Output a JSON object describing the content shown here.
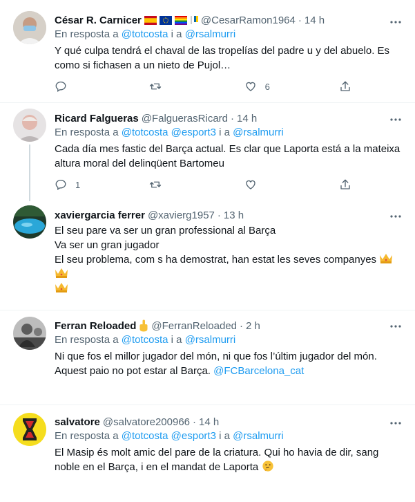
{
  "tweets": [
    {
      "name": "César R. Carnicer",
      "flags": [
        "spain-flag",
        "eu-flag",
        "pride-flag",
        "canary-flag"
      ],
      "handle": "@CesarRamon1964",
      "dot": "·",
      "time": "14 h",
      "reply_prefix": "En resposta a",
      "reply_mentions": [
        "@totcosta",
        "@rsalmurri"
      ],
      "reply_join": [
        "i a"
      ],
      "text": "Y qué culpa tendrá el chaval de las tropelías del padre u y del abuelo. Es como si fichasen a un nieto de Pujol…",
      "replies": "",
      "retweets": "",
      "likes": "6"
    },
    {
      "name": "Ricard Falgueras",
      "handle": "@FalguerasRicard",
      "dot": "·",
      "time": "14 h",
      "reply_prefix": "En resposta a",
      "reply_mentions": [
        "@totcosta",
        "@esport3",
        "@rsalmurri"
      ],
      "reply_join": [
        "i a"
      ],
      "text": "Cada día mes fastic del Barça actual. Es clar que Laporta está a la mateixa altura moral del delinqüent Bartomeu",
      "replies": "1",
      "retweets": "",
      "likes": ""
    },
    {
      "name": "xaviergarcia ferrer",
      "handle": "@xavierg1957",
      "dot": "·",
      "time": "13 h",
      "lines": [
        "El seu pare va ser un gran professional al Barça",
        "Va ser un gran jugador",
        "El seu problema, com s ha demostrat, han estat les seves companyes"
      ],
      "replies": "",
      "retweets": "",
      "likes": ""
    },
    {
      "name": "Ferran Reloaded",
      "handle": "@FerranReloaded",
      "dot": "·",
      "time": "2 h",
      "reply_prefix": "En resposta a",
      "reply_mentions": [
        "@totcosta",
        "@rsalmurri"
      ],
      "reply_join": [
        "i a"
      ],
      "text": "Ni que fos el millor jugador del món, ni que fos l’últim jugador del món. Aquest paio no pot estar al Barça.",
      "text_link": "@FCBarcelona_cat",
      "replies": "",
      "retweets": "",
      "likes": ""
    },
    {
      "name": "salvatore",
      "handle": "@salvatore200966",
      "dot": "·",
      "time": "14 h",
      "reply_prefix": "En resposta a",
      "reply_mentions": [
        "@totcosta",
        "@esport3",
        "@rsalmurri"
      ],
      "reply_join": [
        "i a"
      ],
      "text": "El Masip és molt amic del pare de la criatura. Qui ho havia de dir, sang noble en el Barça, i en el mandat de Laporta",
      "replies": "",
      "retweets": "",
      "likes": ""
    }
  ],
  "colors": {
    "text": "#0f1419",
    "secondary": "#536471",
    "link": "#1d9bf0",
    "separator": "#eff3f4"
  }
}
